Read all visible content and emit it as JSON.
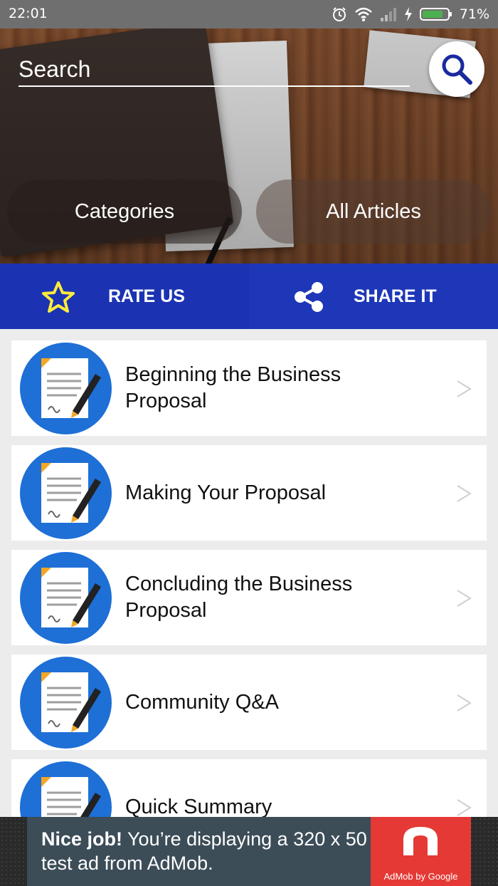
{
  "status_bar": {
    "time": "22:01",
    "battery": "71%"
  },
  "search": {
    "placeholder": "Search"
  },
  "hero": {
    "categories_label": "Categories",
    "all_articles_label": "All Articles"
  },
  "actions": {
    "rate_label": "RATE US",
    "share_label": "SHARE IT"
  },
  "articles": [
    {
      "title": "Beginning the Business Proposal"
    },
    {
      "title": "Making Your Proposal"
    },
    {
      "title": "Concluding the Business Proposal"
    },
    {
      "title": "Community Q&A"
    },
    {
      "title": "Quick Summary"
    }
  ],
  "ad": {
    "headline": "Nice job!",
    "body": " You’re displaying a 320 x 50 test ad from AdMob.",
    "brand": "AdMob by Google"
  },
  "colors": {
    "action_bar": "#1c35b4",
    "icon_circle": "#1e6fd6",
    "star": "#ffeb3b",
    "ad_red": "#e53935"
  }
}
